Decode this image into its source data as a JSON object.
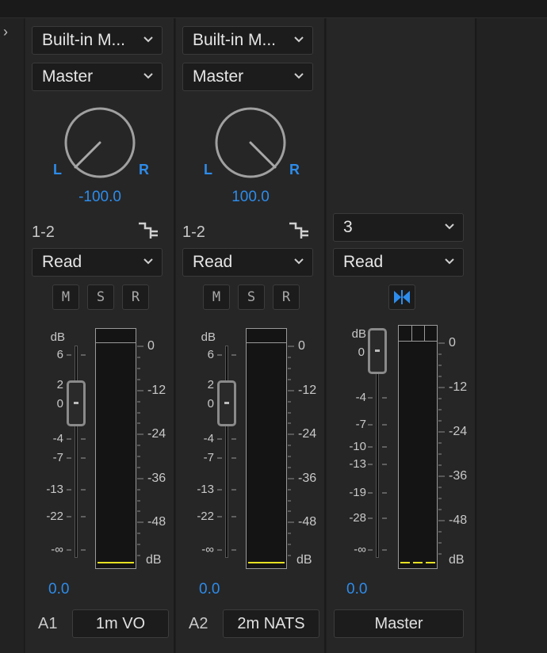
{
  "strips": [
    {
      "output": "Built-in M...",
      "send": "Master",
      "pan_value": "-100.0",
      "pan_left": "L",
      "pan_right": "R",
      "channels": "1-2",
      "automation": "Read",
      "mute": "M",
      "solo": "S",
      "record": "R",
      "fader_scale": [
        "dB",
        "6",
        "2",
        "0",
        "-4",
        "-7",
        "-13",
        "-22",
        "-∞"
      ],
      "volume": "0.0",
      "track_id": "A1",
      "track_name": "1m VO"
    },
    {
      "output": "Built-in M...",
      "send": "Master",
      "pan_value": "100.0",
      "pan_left": "L",
      "pan_right": "R",
      "channels": "1-2",
      "automation": "Read",
      "mute": "M",
      "solo": "S",
      "record": "R",
      "fader_scale": [
        "dB",
        "6",
        "2",
        "0",
        "-4",
        "-7",
        "-13",
        "-22",
        "-∞"
      ],
      "volume": "0.0",
      "track_id": "A2",
      "track_name": "2m NATS"
    },
    {
      "output": "3",
      "automation": "Read",
      "fader_scale": [
        "dB",
        "0",
        "-4",
        "-7",
        "-10",
        "-13",
        "-19",
        "-28",
        "-∞"
      ],
      "volume": "0.0",
      "track_name": "Master"
    }
  ],
  "meter_scale": [
    "0",
    "-12",
    "-24",
    "-36",
    "-48",
    "dB"
  ],
  "colors": {
    "accent_blue": "#2d8ceb",
    "meter_level": "#e7e021",
    "panel": "#262626"
  },
  "icons": {
    "expand": "chevron-right-icon",
    "routing": "routing-icon",
    "link": "stereo-link-icon"
  }
}
